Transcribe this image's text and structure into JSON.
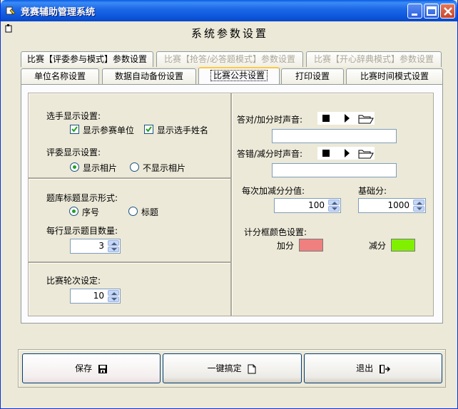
{
  "window": {
    "title": "竞赛辅助管理系统"
  },
  "page_title": "系统参数设置",
  "tabs_row1": [
    {
      "label": "比赛【评委参与模式】参数设置",
      "disabled": false
    },
    {
      "label": "比赛【抢答/必答题模式】参数设置",
      "disabled": true
    },
    {
      "label": "比赛【开心辞典模式】参数设置",
      "disabled": true
    }
  ],
  "tabs_row2": [
    {
      "label": "单位名称设置"
    },
    {
      "label": "数据自动备份设置"
    },
    {
      "label": "比赛公共设置",
      "active": true
    },
    {
      "label": "打印设置"
    },
    {
      "label": "比赛时间模式设置"
    }
  ],
  "contestant": {
    "heading": "选手显示设置:",
    "show_unit_label": "显示参赛单位",
    "show_unit_checked": true,
    "show_name_label": "显示选手姓名",
    "show_name_checked": true
  },
  "judge": {
    "heading": "评委显示设置:",
    "show_photo_label": "显示相片",
    "hide_photo_label": "不显示相片",
    "selected": "show_photo"
  },
  "question_title": {
    "heading": "题库标题显示形式:",
    "serial_label": "序号",
    "title_label": "标题",
    "selected": "serial"
  },
  "per_row": {
    "label": "每行显示题目数量:",
    "value": "3"
  },
  "rounds": {
    "label": "比赛轮次设定:",
    "value": "10"
  },
  "sound": {
    "correct_label": "答对/加分时声音:",
    "wrong_label": "答错/减分时声音:"
  },
  "scoring": {
    "step_label": "每次加减分分值:",
    "step_value": "100",
    "base_label": "基础分:",
    "base_value": "1000"
  },
  "colors": {
    "heading": "计分框颜色设置:",
    "add_label": "加分",
    "add_color": "#f08080",
    "sub_label": "减分",
    "sub_color": "#80f000"
  },
  "buttons": {
    "save": "保存",
    "one_key": "一键搞定",
    "exit": "退出"
  }
}
